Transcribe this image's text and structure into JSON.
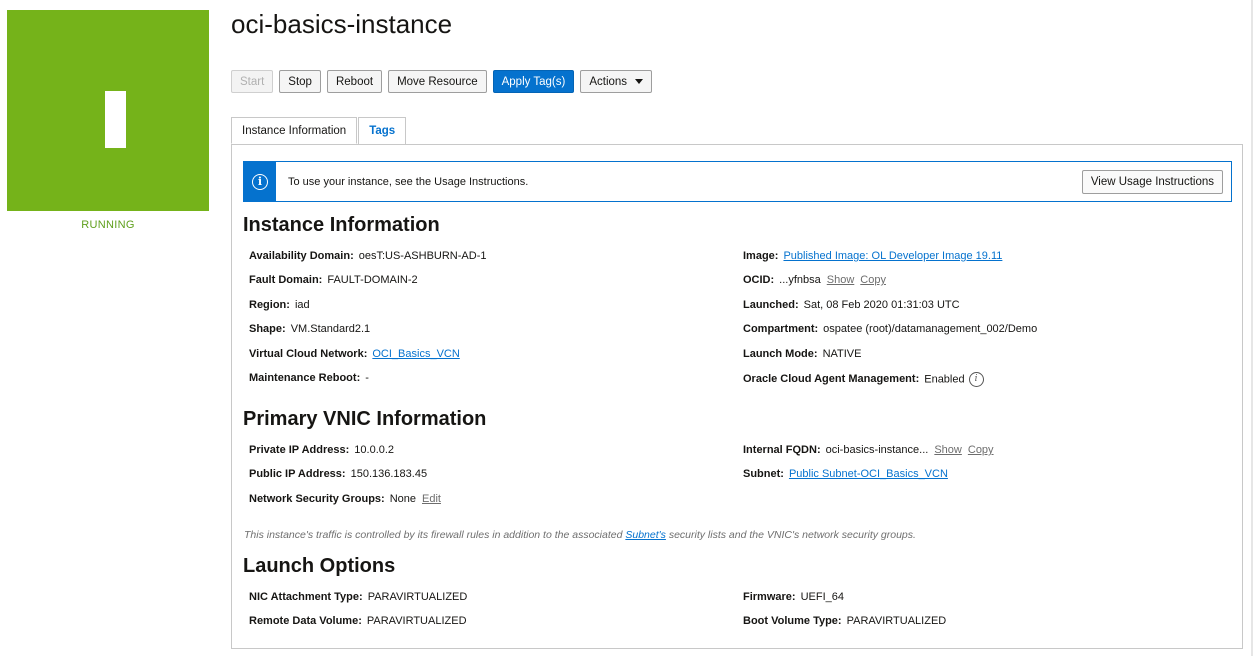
{
  "colors": {
    "running_green": "#75b31a",
    "primary_blue": "#0572ce"
  },
  "status": {
    "letter": "I",
    "label": "RUNNING"
  },
  "title": "oci-basics-instance",
  "toolbar": {
    "start": "Start",
    "stop": "Stop",
    "reboot": "Reboot",
    "move": "Move Resource",
    "apply_tags": "Apply Tag(s)",
    "actions": "Actions"
  },
  "tabs": {
    "instance_info": "Instance Information",
    "tags": "Tags"
  },
  "notice": {
    "message": "To use your instance, see the Usage Instructions.",
    "button": "View Usage Instructions",
    "icon": "info-icon"
  },
  "sections": {
    "instance": "Instance Information",
    "vnic": "Primary VNIC Information",
    "launch": "Launch Options"
  },
  "instance": {
    "ad_label": "Availability Domain:",
    "ad_value": "oesT:US-ASHBURN-AD-1",
    "fd_label": "Fault Domain:",
    "fd_value": "FAULT-DOMAIN-2",
    "region_label": "Region:",
    "region_value": "iad",
    "shape_label": "Shape:",
    "shape_value": "VM.Standard2.1",
    "vcn_label": "Virtual Cloud Network:",
    "vcn_value": "OCI_Basics_VCN",
    "maint_label": "Maintenance Reboot:",
    "maint_value": "-",
    "image_label": "Image:",
    "image_value": "Published Image: OL Developer Image 19.11",
    "ocid_label": "OCID:",
    "ocid_value": "...yfnbsa",
    "show": "Show",
    "copy": "Copy",
    "launched_label": "Launched:",
    "launched_value": "Sat, 08 Feb 2020 01:31:03 UTC",
    "comp_label": "Compartment:",
    "comp_value": "ospatee (root)/datamanagement_002/Demo",
    "mode_label": "Launch Mode:",
    "mode_value": "NATIVE",
    "agent_label": "Oracle Cloud Agent Management:",
    "agent_value": "Enabled"
  },
  "vnic": {
    "private_label": "Private IP Address:",
    "private_value": "10.0.0.2",
    "public_label": "Public IP Address:",
    "public_value": "150.136.183.45",
    "nsg_label": "Network Security Groups:",
    "nsg_value": "None",
    "edit": "Edit",
    "fqdn_label": "Internal FQDN:",
    "fqdn_value": "oci-basics-instance...",
    "show": "Show",
    "copy": "Copy",
    "subnet_label": "Subnet:",
    "subnet_value": "Public Subnet-OCI_Basics_VCN",
    "note_pre": "This instance's traffic is controlled by its firewall rules in addition to the associated ",
    "note_link": "Subnet's",
    "note_post": " security lists and the VNIC's network security groups."
  },
  "launch": {
    "nic_label": "NIC Attachment Type:",
    "nic_value": "PARAVIRTUALIZED",
    "rdv_label": "Remote Data Volume:",
    "rdv_value": "PARAVIRTUALIZED",
    "fw_label": "Firmware:",
    "fw_value": "UEFI_64",
    "bvt_label": "Boot Volume Type:",
    "bvt_value": "PARAVIRTUALIZED"
  }
}
